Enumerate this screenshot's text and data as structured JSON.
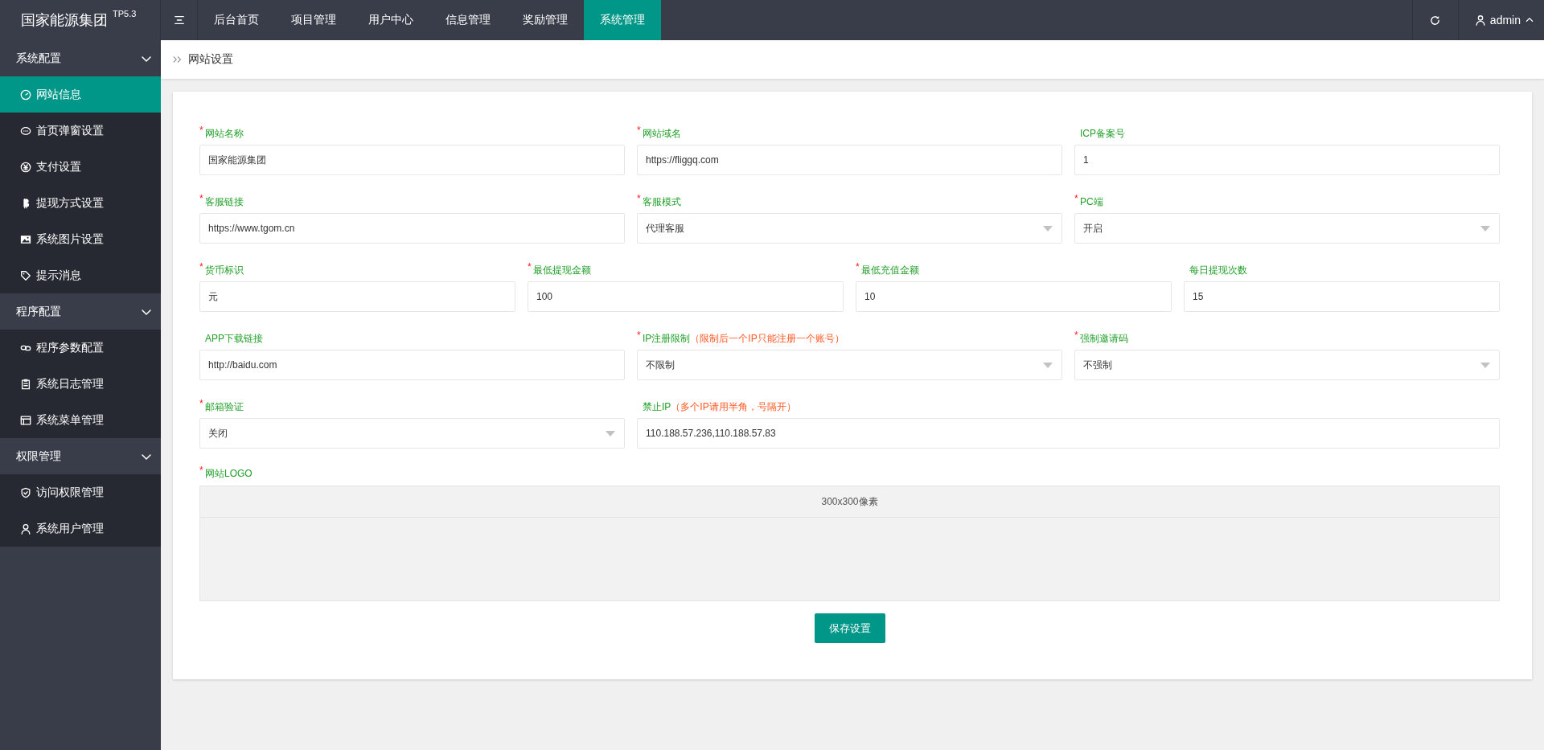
{
  "brand": {
    "name": "国家能源集团",
    "version": "TP5.3"
  },
  "top_nav": {
    "tabs": [
      {
        "label": "后台首页",
        "selected": false
      },
      {
        "label": "项目管理",
        "selected": false
      },
      {
        "label": "用户中心",
        "selected": false
      },
      {
        "label": "信息管理",
        "selected": false
      },
      {
        "label": "奖励管理",
        "selected": false
      },
      {
        "label": "系统管理",
        "selected": true
      }
    ],
    "user": "admin"
  },
  "sidebar": {
    "groups": [
      {
        "label": "系统配置",
        "expanded": true,
        "items": [
          {
            "label": "网站信息",
            "selected": true
          },
          {
            "label": "首页弹窗设置",
            "selected": false
          },
          {
            "label": "支付设置",
            "selected": false
          },
          {
            "label": "提现方式设置",
            "selected": false
          },
          {
            "label": "系统图片设置",
            "selected": false
          },
          {
            "label": "提示消息",
            "selected": false
          }
        ]
      },
      {
        "label": "程序配置",
        "expanded": true,
        "items": [
          {
            "label": "程序参数配置",
            "selected": false
          },
          {
            "label": "系统日志管理",
            "selected": false
          },
          {
            "label": "系统菜单管理",
            "selected": false
          }
        ]
      },
      {
        "label": "权限管理",
        "expanded": true,
        "items": [
          {
            "label": "访问权限管理",
            "selected": false
          },
          {
            "label": "系统用户管理",
            "selected": false
          }
        ]
      }
    ]
  },
  "breadcrumb": "网站设置",
  "form": {
    "rows": [
      [
        {
          "required_mark": "*",
          "label": "网站名称",
          "kind": "input",
          "value": "国家能源集团"
        },
        {
          "required_mark": "*",
          "label": "网站域名",
          "kind": "input",
          "value": "https://fliggq.com"
        },
        {
          "label": "ICP备案号",
          "kind": "input",
          "value": "1"
        }
      ],
      [
        {
          "required_mark": "*",
          "label": "客服链接",
          "kind": "input",
          "value": "https://www.tgom.cn"
        },
        {
          "required_mark": "*",
          "label": "客服模式",
          "kind": "select",
          "value": "代理客服"
        },
        {
          "required_mark": "*",
          "label": "PC端",
          "kind": "select",
          "value": "开启"
        }
      ],
      [
        {
          "required_mark": "*",
          "label": "货币标识",
          "kind": "input",
          "value": "元"
        },
        {
          "required_mark": "*",
          "label": "最低提现金额",
          "kind": "input",
          "value": "100"
        },
        {
          "required_mark": "*",
          "label": "最低充值金额",
          "kind": "input",
          "value": "10"
        },
        {
          "label": "每日提现次数",
          "kind": "input",
          "value": "15"
        }
      ],
      [
        {
          "label": "APP下载链接",
          "kind": "input",
          "value": "http://baidu.com"
        },
        {
          "required_mark": "*",
          "label": "IP注册限制",
          "hint": "（限制后一个IP只能注册一个账号）",
          "kind": "select",
          "value": "不限制"
        },
        {
          "required_mark": "*",
          "label": "强制邀请码",
          "kind": "select",
          "value": "不强制"
        }
      ],
      [
        {
          "required_mark": "*",
          "label": "邮箱验证",
          "kind": "select",
          "value": "关闭"
        },
        {
          "label": "禁止IP",
          "hint": "（多个IP请用半角，号隔开）",
          "kind": "input",
          "value": "110.188.57.236,110.188.57.83"
        }
      ]
    ],
    "logo": {
      "required_mark": "*",
      "label": "网站LOGO",
      "hint": "300x300像素"
    },
    "submit": "保存设置"
  }
}
